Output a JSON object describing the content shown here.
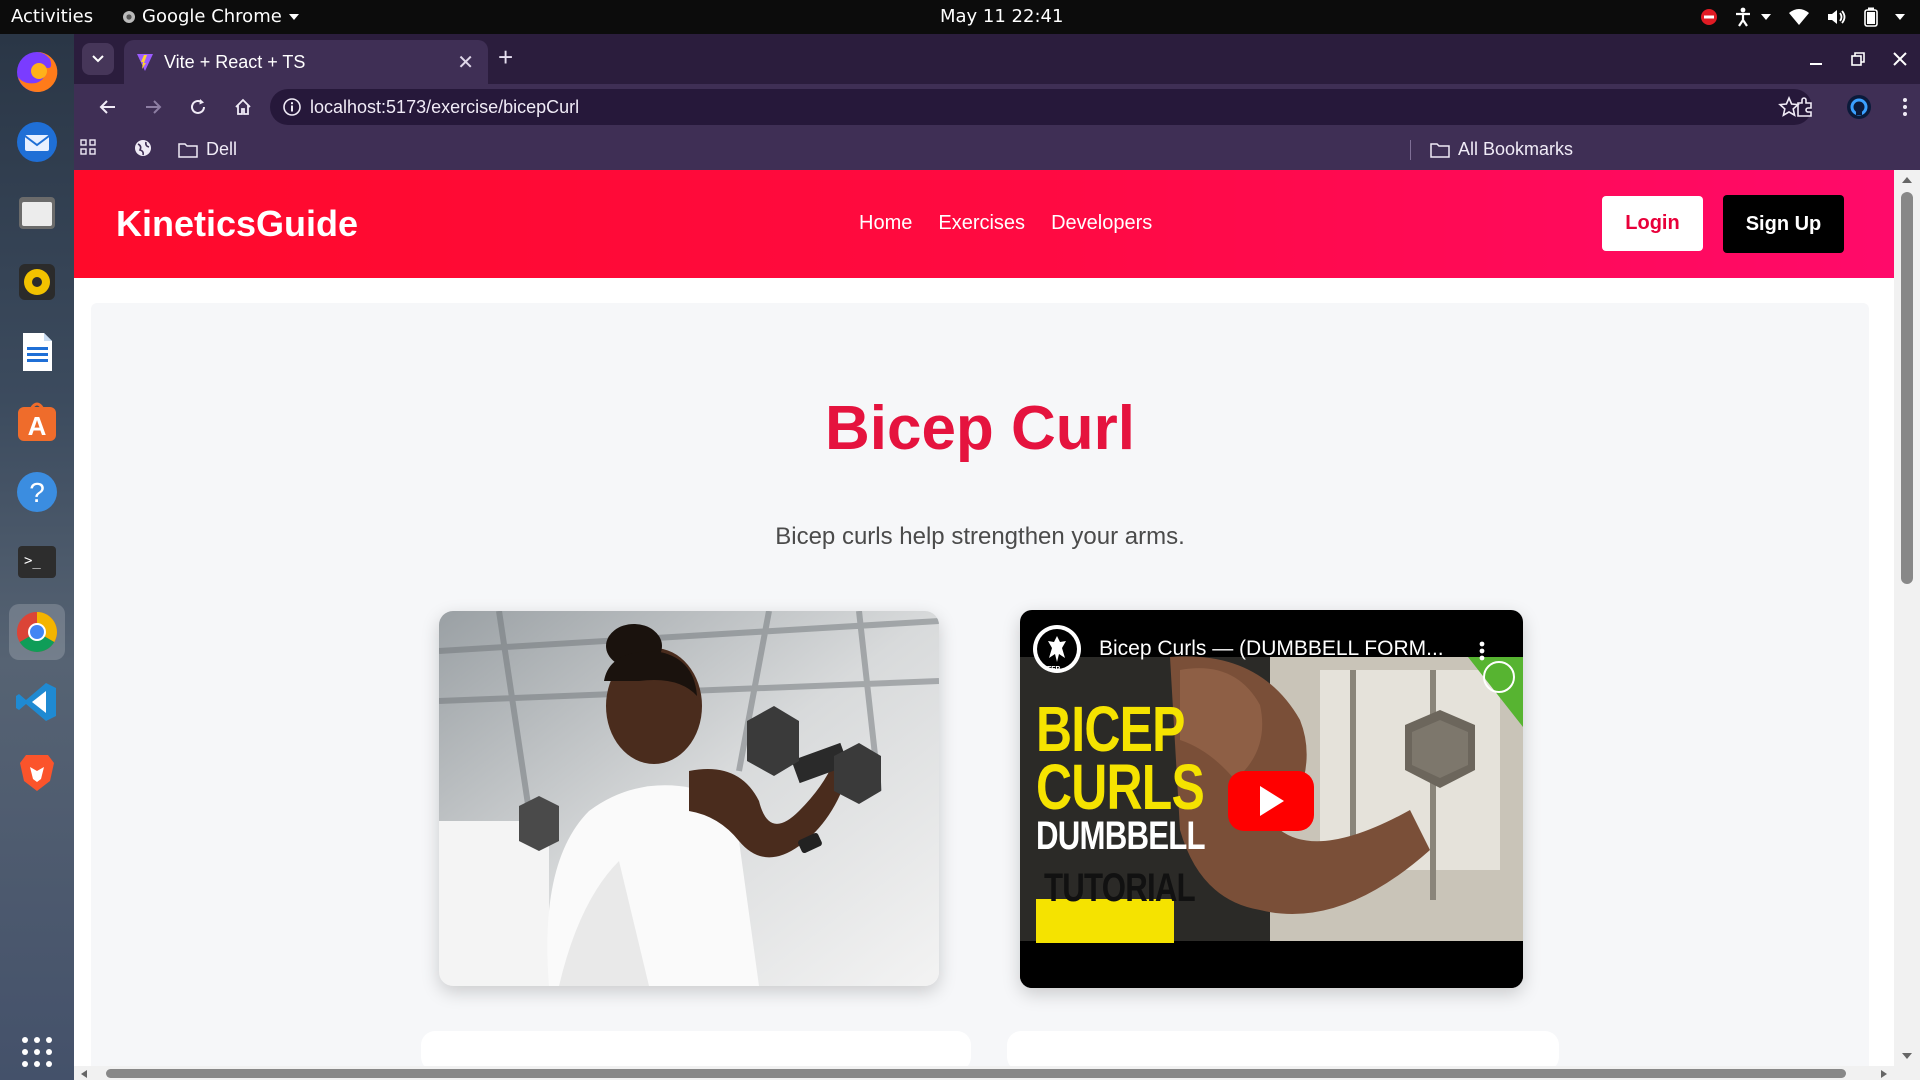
{
  "system": {
    "activities": "Activities",
    "app_name": "Google Chrome",
    "clock": "May 11  22:41"
  },
  "dock": {
    "apps": [
      "firefox-icon",
      "thunderbird-icon",
      "files-icon",
      "rhythmbox-icon",
      "writer-icon",
      "app-center-icon",
      "help-icon",
      "terminal-icon",
      "chrome-icon",
      "vscode-icon",
      "brave-icon",
      "show-apps-icon"
    ]
  },
  "browser": {
    "tab_title": "Vite + React + TS",
    "url": "localhost:5173/exercise/bicepCurl",
    "bookmarks": {
      "folder": "Dell",
      "all": "All Bookmarks"
    }
  },
  "site": {
    "brand": "KineticsGuide",
    "nav": [
      "Home",
      "Exercises",
      "Developers"
    ],
    "login": "Login",
    "signup": "Sign Up",
    "exercise_title": "Bicep Curl",
    "description": "Bicep curls help strengthen your arms.",
    "video": {
      "title": "Bicep Curls — (DUMBBELL FORM...",
      "thumb_line1": "BICEP",
      "thumb_line2": "CURLS",
      "thumb_line3": "DUMBBELL",
      "thumb_line4": "TUTORIAL",
      "channel_badge": "FFP"
    }
  },
  "colors": {
    "header_start": "#ff0a2a",
    "header_end": "#ff0a6a",
    "title_red": "#e5133e",
    "browser_purple": "#3f2f55"
  }
}
